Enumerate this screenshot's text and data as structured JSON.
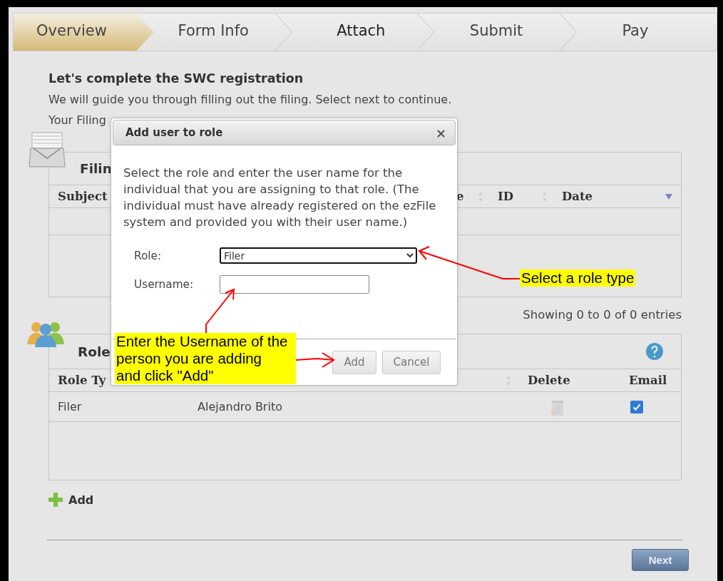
{
  "steps": [
    {
      "label": "Overview",
      "selected": true
    },
    {
      "label": "Form Info",
      "selected": false
    },
    {
      "label": "Attach",
      "selected": false
    },
    {
      "label": "Submit",
      "selected": false
    },
    {
      "label": "Pay",
      "selected": false
    }
  ],
  "intro": {
    "title": "Let's complete the SWC registration",
    "text": "We will guide you through filling out the filing. Select next to continue.",
    "filing_label": "Your Filing"
  },
  "filings_panel": {
    "title": "Filin",
    "columns": [
      {
        "label": "Subject"
      },
      {
        "label": "e",
        "sortable": true,
        "sorted_desc": false
      },
      {
        "label": "ID",
        "sortable": true,
        "sorted_desc": false
      },
      {
        "label": "Date",
        "sortable": false,
        "sorted_desc": true
      }
    ],
    "info": "Showing 0 to 0 of 0 entries"
  },
  "roles_panel": {
    "title": "Role",
    "columns": [
      {
        "label": "Role Ty"
      },
      {
        "sortable": true
      },
      {
        "label": "Delete",
        "sortable": false
      },
      {
        "label": "Email",
        "sortable": false
      }
    ],
    "rows": [
      {
        "role_type": "Filer",
        "name": "Alejandro Brito",
        "email": true
      }
    ],
    "add_link": "Add"
  },
  "next_button": "Next",
  "dialog": {
    "title": "Add user to role",
    "close": "×",
    "text": "Select the role and enter the user name for the individual that you are assigning to that role. (The individual must have already registered on the ezFile system and provided you with their user name.)",
    "role_label": "Role:",
    "role": "Filer",
    "username_label": "Username:",
    "add_button": "Add",
    "cancel_button": "Cancel"
  },
  "callouts": [
    {
      "text": "Select a role type"
    },
    {
      "text": "Enter the Username of the\nperson you are adding\nand click \"Add\""
    }
  ]
}
